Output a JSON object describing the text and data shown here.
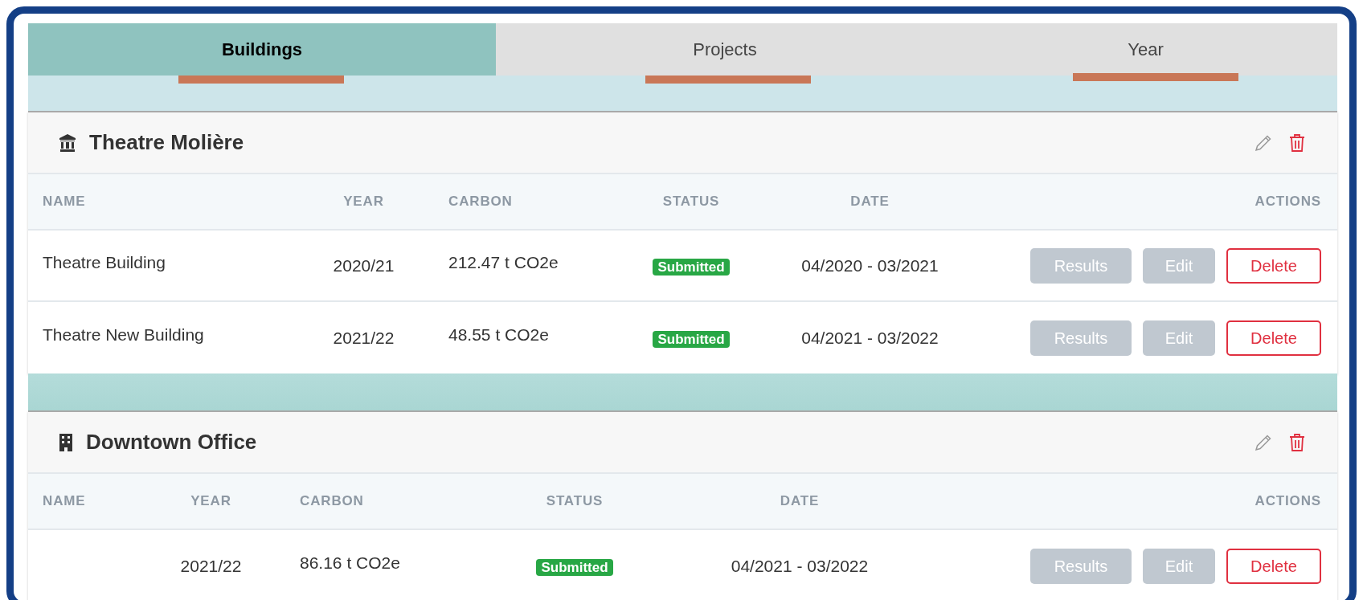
{
  "tabs": [
    {
      "label": "Buildings",
      "selected": true
    },
    {
      "label": "Projects",
      "selected": false
    },
    {
      "label": "Year",
      "selected": false
    }
  ],
  "cards": [
    {
      "title": "Theatre Molière",
      "columns": [
        "NAME",
        "YEAR",
        "CARBON",
        "STATUS",
        "DATE",
        "ACTIONS"
      ],
      "rows": [
        {
          "name": "Theatre Building",
          "year": "2020/21",
          "carbon": "212.47 t CO2e",
          "status": "Submitted",
          "date": "04/2020 - 03/2021",
          "actions": [
            "Results",
            "Edit",
            "Delete"
          ]
        },
        {
          "name": "Theatre New Building",
          "year": "2021/22",
          "carbon": "48.55 t CO2e",
          "status": "Submitted",
          "date": "04/2021 - 03/2022",
          "actions": [
            "Results",
            "Edit",
            "Delete"
          ]
        }
      ]
    },
    {
      "title": "Downtown Office",
      "columns": [
        "NAME",
        "YEAR",
        "CARBON",
        "STATUS",
        "DATE",
        "ACTIONS"
      ],
      "rows": [
        {
          "year": "2021/22",
          "carbon": "86.16 t CO2e",
          "status": "Submitted",
          "date": "04/2021 - 03/2022",
          "actions": [
            "Results",
            "Edit",
            "Delete"
          ]
        }
      ]
    }
  ]
}
